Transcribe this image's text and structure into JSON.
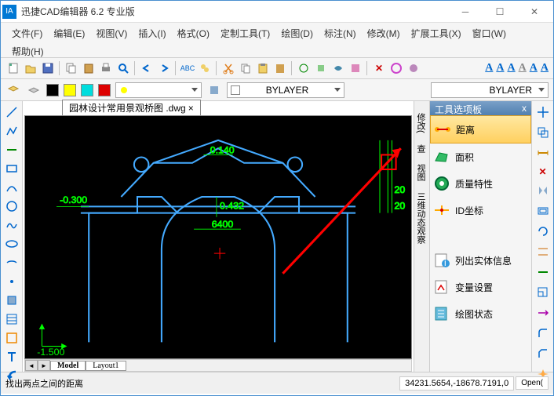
{
  "app": {
    "icon_text": "IA",
    "title": "迅捷CAD编辑器 6.2 专业版"
  },
  "menu": {
    "items": [
      "文件(F)",
      "编辑(E)",
      "视图(V)",
      "插入(I)",
      "格式(O)",
      "定制工具(T)",
      "绘图(D)",
      "标注(N)",
      "修改(M)",
      "扩展工具(X)",
      "窗口(W)",
      "帮助(H)"
    ]
  },
  "toolbar2": {
    "bylayer1": "BYLAYER",
    "bylayer2": "BYLAYER"
  },
  "file": {
    "tab": "园林设计常用景观桥图 .dwg",
    "close": "×"
  },
  "layout": {
    "model": "Model",
    "layout1": "Layout1"
  },
  "side_tabs": [
    "修改(",
    "查",
    "视图",
    "三维动态观察"
  ],
  "palette": {
    "title": "工具选项板",
    "x": "x",
    "items": [
      "距离",
      "面积",
      "质量特性",
      "ID坐标",
      "列出实体信息",
      "变量设置",
      "绘图状态"
    ]
  },
  "status": {
    "help": "找出两点之间的距离",
    "coords": "34231.5654,-18678.7191,0",
    "open": "Open("
  },
  "drawing": {
    "dim1": "0.140",
    "dim2": "-0.300",
    "dim3": "0.432",
    "dim4": "6400",
    "dim5": "-1.500",
    "dim6": "20",
    "dim7": "20"
  },
  "text_tools": [
    "A",
    "A",
    "A",
    "A",
    "A",
    "A"
  ]
}
